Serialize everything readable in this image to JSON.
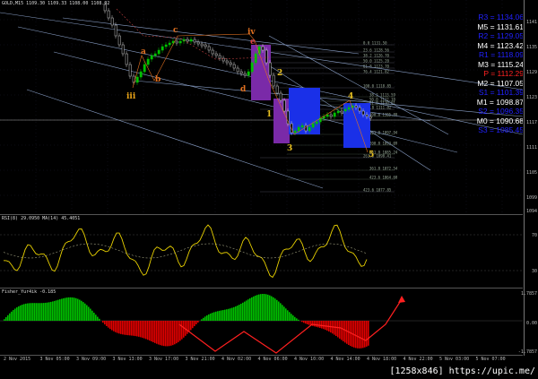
{
  "main": {
    "title": "GOLD,M15  1109.30 1109.33 1108.00 1108.92",
    "price_ticks": [
      "1141",
      "1135",
      "1129",
      "1123",
      "1117",
      "1111",
      "1105",
      "1099",
      "1094"
    ],
    "wave_labels": [
      {
        "text": "iii",
        "color": "#e8a317"
      },
      {
        "text": "a",
        "color": "#e07020"
      },
      {
        "text": "b",
        "color": "#e07020"
      },
      {
        "text": "c",
        "color": "#e07020"
      },
      {
        "text": "iv",
        "color": "#e07020"
      },
      {
        "text": "e",
        "color": "#e04040"
      },
      {
        "text": "d",
        "color": "#e07020"
      },
      {
        "text": "2",
        "color": "#e8c020"
      },
      {
        "text": "1",
        "color": "#e8c020"
      },
      {
        "text": "3",
        "color": "#e8c020"
      },
      {
        "text": "4",
        "color": "#e8c020"
      },
      {
        "text": "5",
        "color": "#e8c020"
      }
    ],
    "fibo_levels": [
      "0.0  1131.50",
      "23.6  1128.56",
      "38.2  1126.70",
      "50.0  1125.20",
      "61.8  1123.70",
      "76.4  1121.82",
      "100.0  1118.85",
      "161.8  1111.02",
      "261.8  1098.41",
      "423.6  1077.85"
    ],
    "fibo_levels2": [
      "38.2  1113.59",
      "50.0  1112.10",
      "61.8  1110.61",
      "100.0  1105.80",
      "161.8  1097.94",
      "200.0  1093.09",
      "261.8  1085.24",
      "361.8  1072.54",
      "423.6  1064.68"
    ]
  },
  "pivot_levels": [
    {
      "label": "R3 = 1134.06",
      "color": "#2222ff"
    },
    {
      "label": "M5 = 1131.61",
      "color": "#ffffff"
    },
    {
      "label": "R2 = 1129.05",
      "color": "#2222ff"
    },
    {
      "label": "M4 = 1123.42",
      "color": "#ffffff"
    },
    {
      "label": "R1 = 1118.09",
      "color": "#2222ff"
    },
    {
      "label": "M3 = 1115.24",
      "color": "#ffffff"
    },
    {
      "label": "P = 1112.29",
      "color": "#ff2222"
    },
    {
      "label": "M2 = 1107.05",
      "color": "#ffffff"
    },
    {
      "label": "S1 = 1101.39",
      "color": "#2222ff"
    },
    {
      "label": "M1 = 1098.87",
      "color": "#ffffff"
    },
    {
      "label": "S2 = 1096.35",
      "color": "#2222ff"
    },
    {
      "label": "M0 = 1090.68",
      "color": "#ffffff"
    },
    {
      "label": "S3 = 1085.45",
      "color": "#2222ff"
    }
  ],
  "rsi": {
    "title": "RSI(8) 29.0950  MA(14) 45.4051",
    "ticks": [
      "70",
      "30"
    ]
  },
  "fisher": {
    "title": "Fisher_Yur4ik -0.185",
    "ticks": [
      "1.7857",
      "0.00",
      "-1.7857"
    ]
  },
  "time_labels": [
    "2 Nov 2015",
    "3 Nov 05:00",
    "3 Nov 09:00",
    "3 Nov 13:00",
    "3 Nov 17:00",
    "3 Nov 21:00",
    "4 Nov 02:00",
    "4 Nov 06:00",
    "4 Nov 10:00",
    "4 Nov 14:00",
    "4 Nov 18:00",
    "4 Nov 22:00",
    "5 Nov 03:00",
    "5 Nov 07:00"
  ],
  "watermark": "[1258x846] https://upic.me/",
  "colors": {
    "bull": "#00c000",
    "bear": "#e00000",
    "rsi": "#e8d000",
    "grid": "#1a1a2a",
    "box_purple": "#7a2aa8",
    "box_blue": "#1a30e8",
    "trend": "#8aa0c8",
    "wave": "#e07020",
    "arrow": "#ff2020"
  }
}
